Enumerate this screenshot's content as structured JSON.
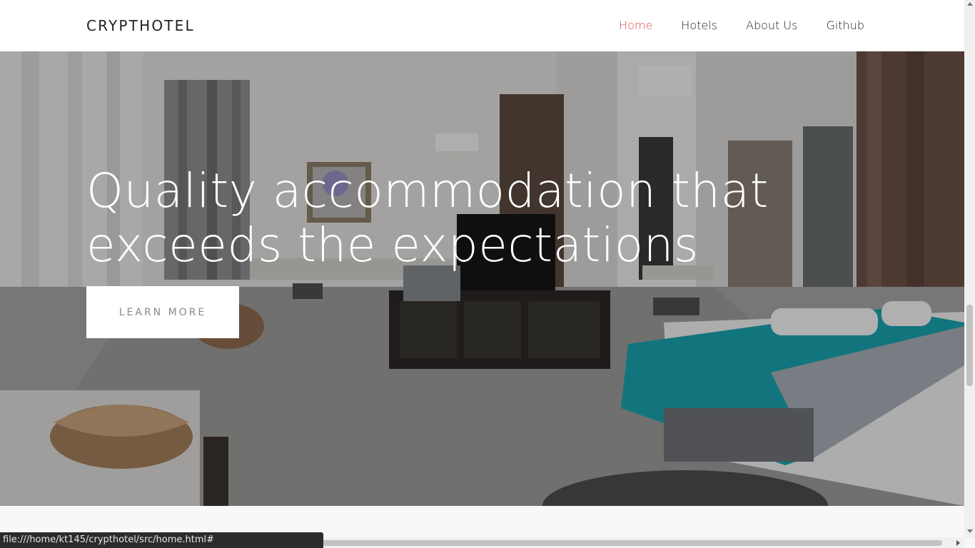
{
  "navbar": {
    "brand": "CRYPTHOTEL",
    "links": [
      {
        "label": "Home",
        "active": true
      },
      {
        "label": "Hotels",
        "active": false
      },
      {
        "label": "About Us",
        "active": false
      },
      {
        "label": "Github",
        "active": false
      }
    ]
  },
  "hero": {
    "title_line1": "Quality accommodation that",
    "title_line2": "exceeds the expectations",
    "cta_label": "LEARN MORE",
    "background_image": "hotel-room-photo"
  },
  "status_bar": {
    "url": "file:///home/kt145/crypthotel/src/home.html#"
  },
  "colors": {
    "accent": "#e04b4b",
    "navbar_bg": "#ffffff",
    "text": "#222222"
  }
}
